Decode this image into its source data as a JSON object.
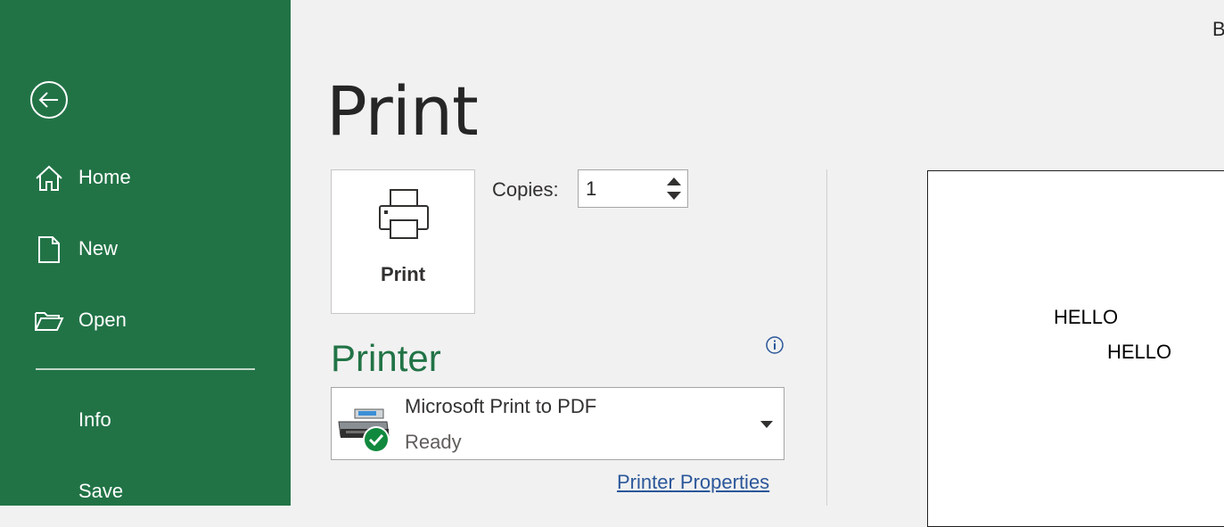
{
  "sidebar": {
    "back_icon": "back-arrow-circle-icon",
    "items": [
      {
        "label": "Home",
        "icon": "home-icon"
      },
      {
        "label": "New",
        "icon": "new-document-icon"
      },
      {
        "label": "Open",
        "icon": "open-folder-icon"
      },
      {
        "label": "Info"
      },
      {
        "label": "Save"
      }
    ],
    "background_color": "#217346"
  },
  "header": {
    "title": "Print",
    "top_right_letter": "B"
  },
  "print_button": {
    "label": "Print",
    "icon": "printer-icon"
  },
  "copies": {
    "label": "Copies:",
    "value": "1"
  },
  "printer": {
    "heading": "Printer",
    "heading_color": "#217346",
    "name": "Microsoft Print to PDF",
    "status": "Ready",
    "properties_link": "Printer Properties",
    "info_icon": "info-icon"
  },
  "preview": {
    "lines": [
      "HELLO",
      "HELLO"
    ]
  }
}
